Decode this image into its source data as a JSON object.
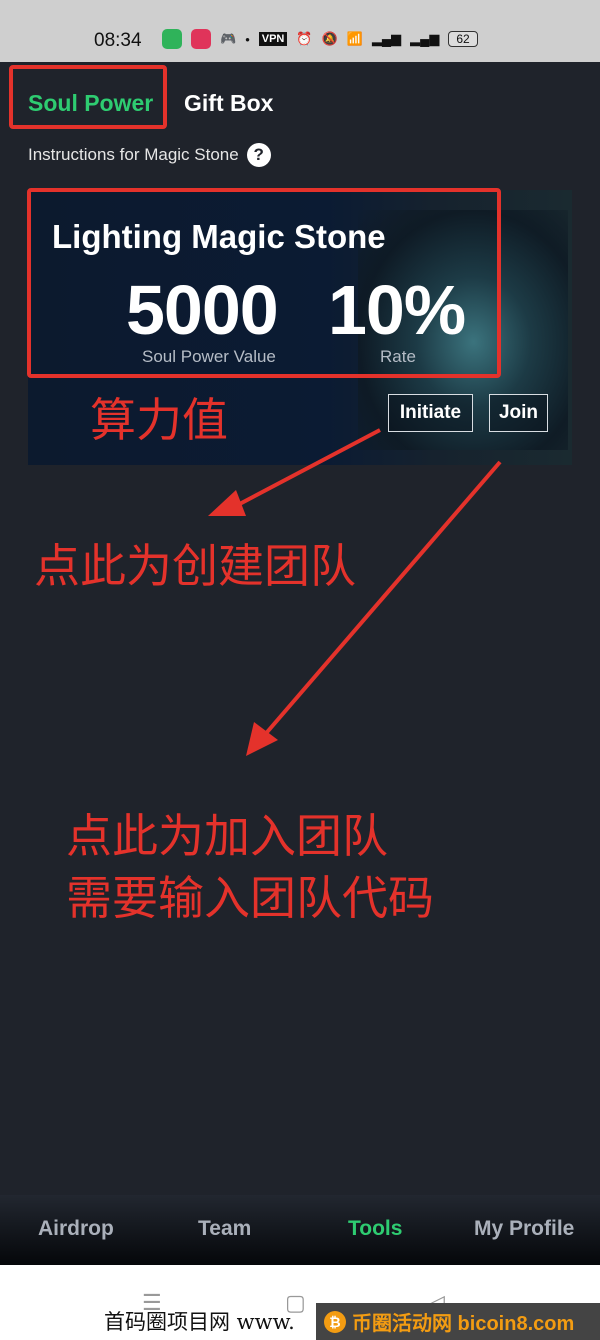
{
  "status_bar": {
    "time": "08:34",
    "vpn": "VPN",
    "battery": "62"
  },
  "tabs": [
    {
      "label": "Soul Power",
      "active": true
    },
    {
      "label": "Gift Box",
      "active": false
    }
  ],
  "instructions": {
    "label": "Instructions for Magic Stone",
    "icon": "question-circle-icon"
  },
  "card": {
    "title": "Lighting Magic Stone",
    "soul_power_value": "5000",
    "soul_power_label": "Soul Power Value",
    "rate_value": "10%",
    "rate_label": "Rate",
    "initiate_label": "Initiate",
    "join_label": "Join"
  },
  "annotations": {
    "compute_value": "算力值",
    "create_team": "点此为创建团队",
    "join_team_line1": "点此为加入团队",
    "join_team_line2": "需要输入团队代码",
    "color": "#e4322b"
  },
  "bottom_nav": [
    {
      "label": "Airdrop"
    },
    {
      "label": "Team"
    },
    {
      "label": "Tools",
      "active": true
    },
    {
      "label": "My Profile"
    }
  ],
  "accent_color": "#2ecc71",
  "watermarks": {
    "left": "首码圈项目网 www.",
    "right": "币圈活动网 bicoin8.com"
  }
}
